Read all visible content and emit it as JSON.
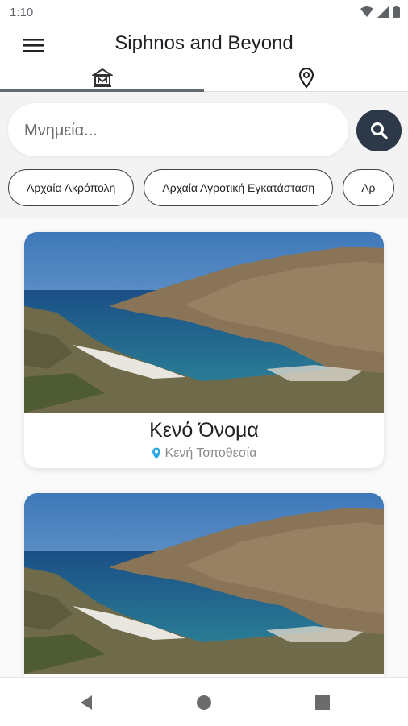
{
  "status_bar": {
    "time": "1:10"
  },
  "app_bar": {
    "title": "Siphnos and Beyond",
    "menu_icon": "hamburger-menu-icon"
  },
  "tabs": [
    {
      "icon": "museum-icon",
      "selected": true
    },
    {
      "icon": "map-pin-icon",
      "selected": false
    }
  ],
  "search": {
    "placeholder": "Μνημεία...",
    "value": "",
    "button_icon": "search-icon"
  },
  "chips": [
    {
      "label": "Αρχαία Ακρόπολη"
    },
    {
      "label": "Αρχαία Αγροτική Εγκατάσταση"
    },
    {
      "label": "Αρ"
    }
  ],
  "cards": [
    {
      "name": "Κενό Όνομα",
      "location": "Κενή Τοποθεσία",
      "location_icon": "location-pin-icon",
      "image": "island-bay-photo"
    },
    {
      "name": "",
      "location": "",
      "image": "island-bay-photo"
    }
  ],
  "nav_bar": {
    "back_icon": "back-triangle-icon",
    "home_icon": "home-circle-icon",
    "recents_icon": "recents-square-icon"
  },
  "colors": {
    "accent": "#2d3848",
    "pin": "#29a8e0",
    "tab_indicator": "#636b72"
  }
}
